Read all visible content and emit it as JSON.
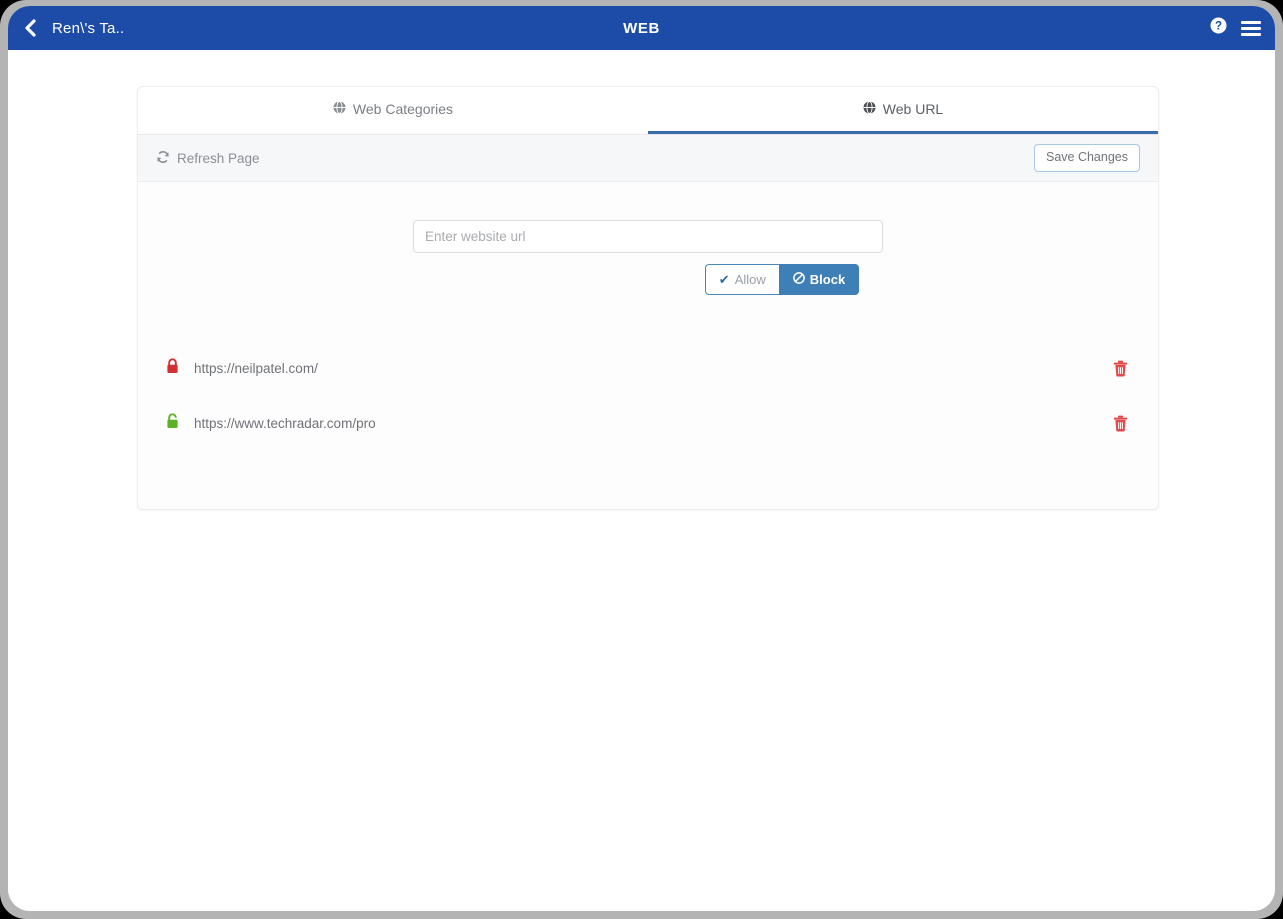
{
  "appbar": {
    "back_icon": "chevron-left-icon",
    "back_title": "Ren\\'s Ta..",
    "title": "WEB",
    "help_icon": "help-circle-icon",
    "menu_icon": "hamburger-menu-icon",
    "background_color": "#1c4ca8"
  },
  "tabs": [
    {
      "id": "web-categories",
      "label": "Web Categories",
      "icon": "globe-icon",
      "active": false
    },
    {
      "id": "web-url",
      "label": "Web URL",
      "icon": "globe-icon",
      "active": true
    }
  ],
  "toolbar": {
    "refresh_label": "Refresh Page",
    "refresh_icon": "refresh-icon",
    "save_label": "Save Changes"
  },
  "form": {
    "url_placeholder": "Enter website url",
    "url_value": "",
    "allow_label": "Allow",
    "allow_icon": "check-icon",
    "allow_selected": false,
    "block_label": "Block",
    "block_icon": "ban-icon",
    "block_selected": true,
    "active_color": "#3f7fb8"
  },
  "url_list": [
    {
      "url": "https://neilpatel.com/",
      "status": "blocked",
      "status_icon": "lock-closed-icon",
      "status_color": "#d0302f",
      "delete_icon": "trash-icon"
    },
    {
      "url": "https://www.techradar.com/pro",
      "status": "allowed",
      "status_icon": "lock-open-icon",
      "status_color": "#5cb226",
      "delete_icon": "trash-icon"
    }
  ]
}
